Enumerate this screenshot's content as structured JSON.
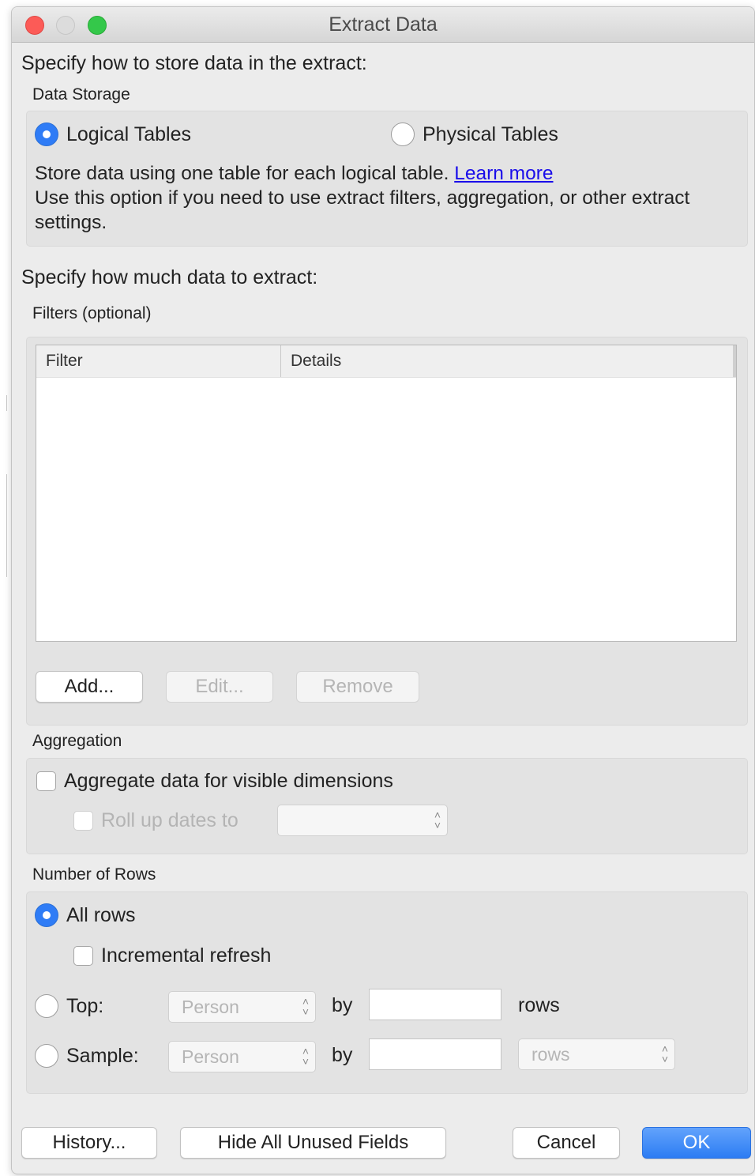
{
  "window": {
    "title": "Extract Data"
  },
  "storage": {
    "heading": "Specify how to store data in the extract:",
    "section_label": "Data Storage",
    "options": [
      {
        "label": "Logical Tables",
        "selected": true
      },
      {
        "label": "Physical Tables",
        "selected": false
      }
    ],
    "description_line1": "Store data using one table for each logical table.",
    "learn_more": "Learn more",
    "description_line2": "Use this option if you need to use extract filters, aggregation, or other extract settings."
  },
  "amount": {
    "heading": "Specify how much data to extract:",
    "filters_label": "Filters (optional)",
    "columns": [
      "Filter",
      "Details"
    ],
    "rows": [],
    "buttons": {
      "add": "Add...",
      "edit": "Edit...",
      "remove": "Remove"
    }
  },
  "aggregation": {
    "section_label": "Aggregation",
    "aggregate_label": "Aggregate data for visible dimensions",
    "aggregate_checked": false,
    "rollup_label": "Roll up dates to",
    "rollup_checked": false,
    "rollup_value": ""
  },
  "rows": {
    "section_label": "Number of Rows",
    "all_rows_label": "All rows",
    "all_rows_selected": true,
    "incremental_label": "Incremental refresh",
    "incremental_checked": false,
    "top_label": "Top:",
    "top_field": "Person",
    "by_label": "by",
    "top_value": "",
    "rows_unit": "rows",
    "sample_label": "Sample:",
    "sample_field": "Person",
    "sample_value": "",
    "sample_unit": "rows"
  },
  "footer": {
    "history": "History...",
    "hide_unused": "Hide All Unused Fields",
    "cancel": "Cancel",
    "ok": "OK"
  }
}
